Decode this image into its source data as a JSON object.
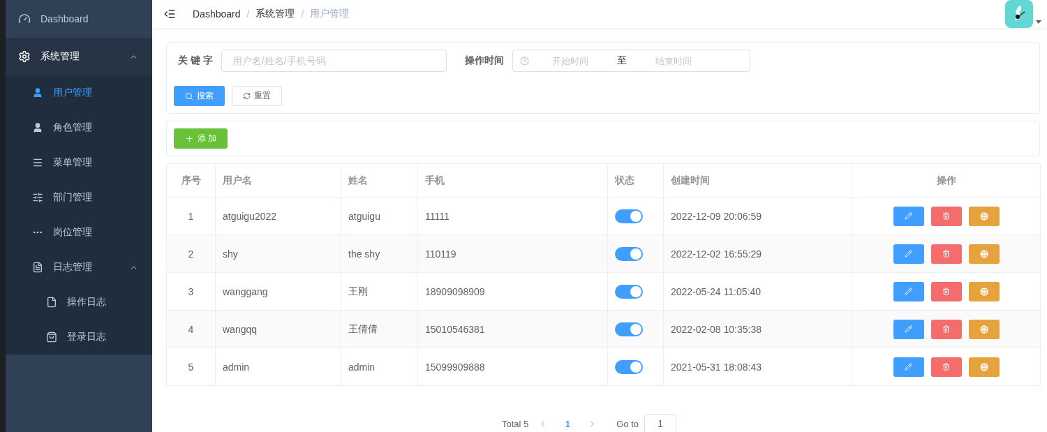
{
  "sidebar": {
    "items": [
      {
        "label": "Dashboard",
        "selected": false
      },
      {
        "label": "系统管理",
        "selected": false,
        "expanded": true,
        "children": [
          {
            "label": "用户管理",
            "selected": true
          },
          {
            "label": "角色管理",
            "selected": false
          },
          {
            "label": "菜单管理",
            "selected": false
          },
          {
            "label": "部门管理",
            "selected": false
          },
          {
            "label": "岗位管理",
            "selected": false
          },
          {
            "label": "日志管理",
            "selected": false,
            "expanded": true,
            "children": [
              {
                "label": "操作日志",
                "selected": false
              },
              {
                "label": "登录日志",
                "selected": false
              }
            ]
          }
        ]
      }
    ]
  },
  "breadcrumb": {
    "separator": "/",
    "items": [
      "Dashboard",
      "系统管理",
      "用户管理"
    ]
  },
  "search": {
    "keyword_label": "关 键 字",
    "keyword_placeholder": "用户名/姓名/手机号码",
    "time_label": "操作时间",
    "start_placeholder": "开始时间",
    "range_separator": "至",
    "end_placeholder": "结束时间",
    "search_button": "搜索",
    "reset_button": "重置"
  },
  "toolbar": {
    "add_button": "添 加"
  },
  "table": {
    "columns": [
      "序号",
      "用户名",
      "姓名",
      "手机",
      "状态",
      "创建时间",
      "操作"
    ],
    "rows": [
      {
        "index": "1",
        "username": "atguigu2022",
        "name": "atguigu",
        "phone": "11111",
        "on": true,
        "created": "2022-12-09 20:06:59"
      },
      {
        "index": "2",
        "username": "shy",
        "name": "the shy",
        "phone": "110119",
        "on": true,
        "created": "2022-12-02 16:55:29"
      },
      {
        "index": "3",
        "username": "wanggang",
        "name": "王刚",
        "phone": "18909098909",
        "on": true,
        "created": "2022-05-24 11:05:40"
      },
      {
        "index": "4",
        "username": "wangqq",
        "name": "王倩倩",
        "phone": "15010546381",
        "on": true,
        "created": "2022-02-08 10:35:38"
      },
      {
        "index": "5",
        "username": "admin",
        "name": "admin",
        "phone": "15099909888",
        "on": true,
        "created": "2021-05-31 18:08:43"
      }
    ]
  },
  "pagination": {
    "total": "Total 5",
    "pages": [
      {
        "label": "1",
        "selected": true
      }
    ],
    "goto_label": "Go to",
    "goto_value": "1"
  }
}
